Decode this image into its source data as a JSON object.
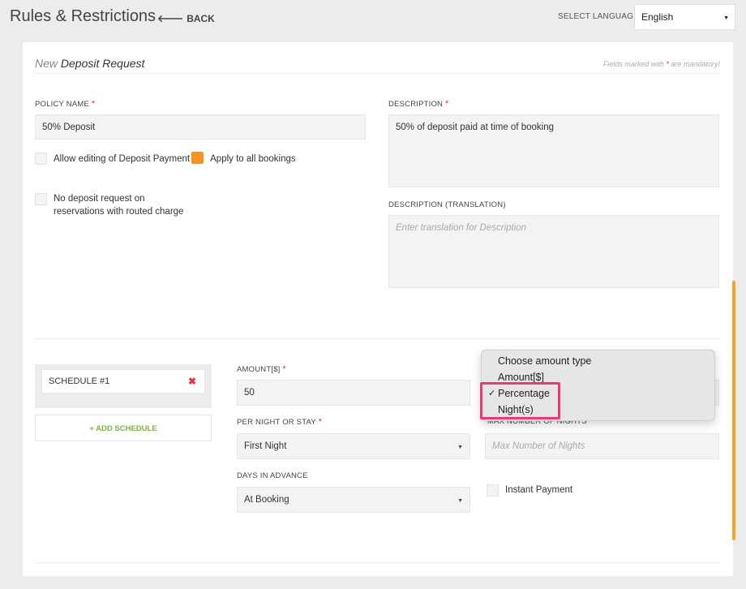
{
  "header": {
    "title": "Rules & Restrictions",
    "back_label": "BACK",
    "language_label": "SELECT LANGUAGE",
    "language_value": "English"
  },
  "form": {
    "title_prefix": "New",
    "title_main": "Deposit Request",
    "mandatory_note_prefix": "Fields marked with",
    "mandatory_note_star": "*",
    "mandatory_note_suffix": "are mandatory!",
    "policy_name_label": "POLICY NAME",
    "policy_name_value": "50% Deposit",
    "description_label": "DESCRIPTION",
    "description_value": "50% of deposit paid at time of booking",
    "description_translation_label": "DESCRIPTION (TRANSLATION)",
    "description_translation_placeholder": "Enter translation for Description",
    "allow_editing_label": "Allow editing of Deposit Payment",
    "apply_all_label": "Apply to all bookings",
    "no_deposit_line1": "No deposit request on",
    "no_deposit_line2": "reservations with routed charge",
    "required_star": "*"
  },
  "schedule": {
    "item_label": "SCHEDULE #1",
    "remove_icon": "✖",
    "add_label": "+ ADD SCHEDULE",
    "amount_label": "AMOUNT[$]",
    "amount_value": "50",
    "per_night_label": "PER NIGHT OR STAY",
    "per_night_value": "First Night",
    "max_nights_label": "MAX NUMBER OF NIGHTS",
    "max_nights_placeholder": "Max Number of Nights",
    "days_advance_label": "DAYS IN ADVANCE",
    "days_advance_value": "At Booking",
    "instant_payment_label": "Instant Payment"
  },
  "amount_type_dropdown": {
    "options": [
      "Choose amount type",
      "Amount[$]",
      "Percentage",
      "Night(s)"
    ],
    "selected": "Percentage",
    "check_mark": "✓"
  },
  "colors": {
    "accent": "#f5a623",
    "required": "#e33333",
    "add_schedule": "#7cb342",
    "highlight": "#ea3a72"
  }
}
